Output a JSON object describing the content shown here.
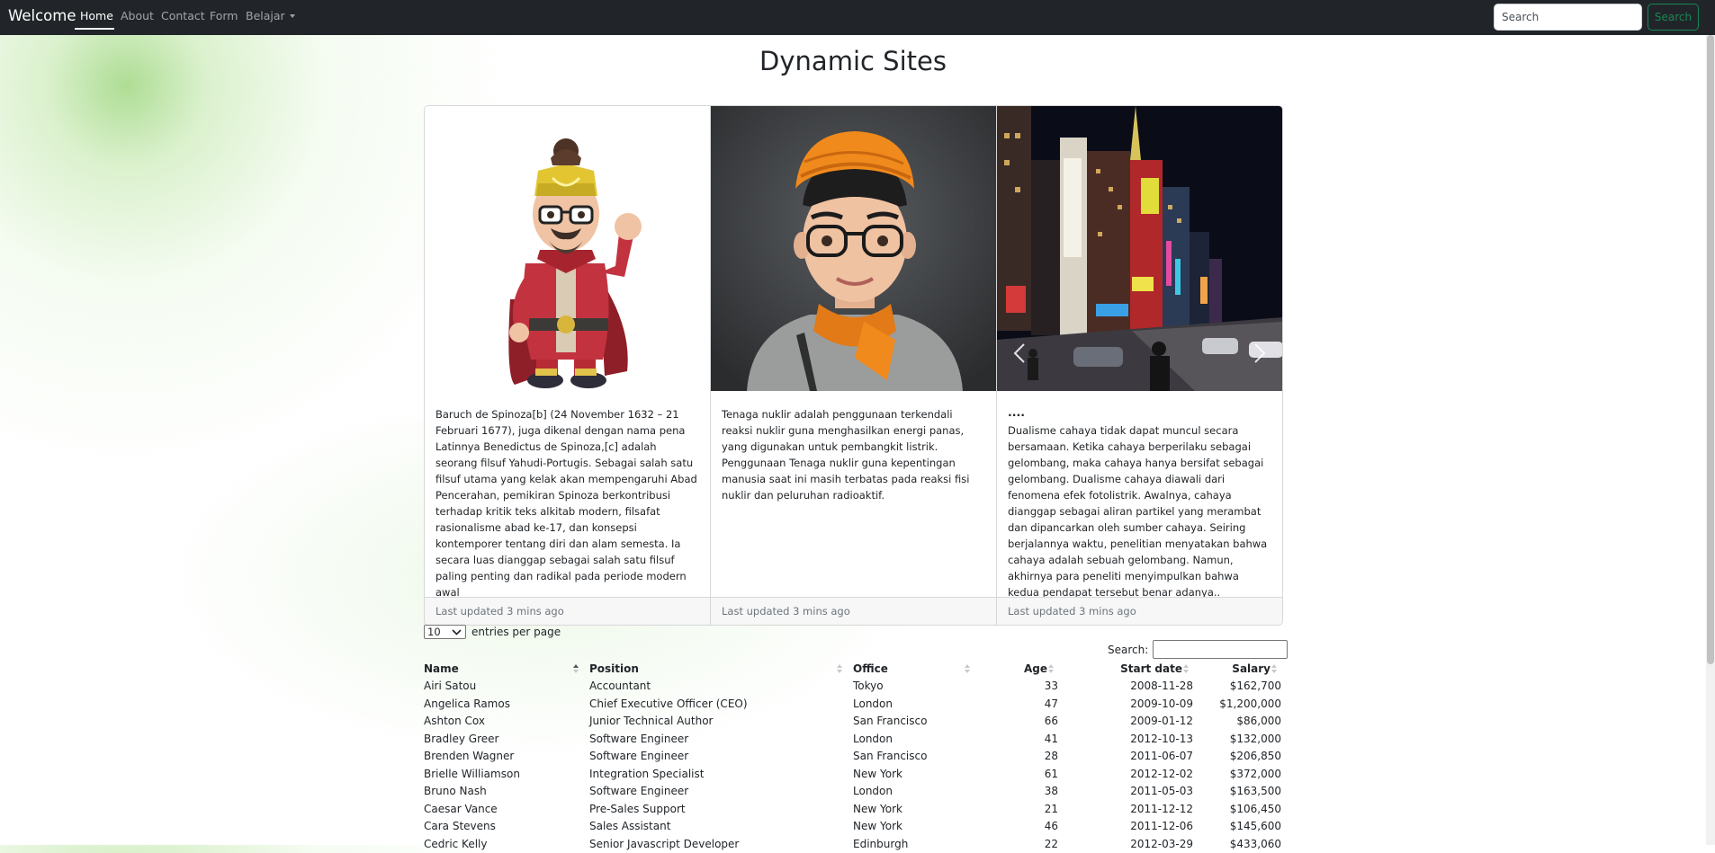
{
  "navbar": {
    "brand": "Welcome",
    "links": [
      "Home",
      "About",
      "Contact",
      "Form",
      "Belajar"
    ],
    "active": "Home",
    "search_placeholder": "Search",
    "search_button": "Search",
    "button_color": "#198754"
  },
  "page_title": "Dynamic Sites",
  "cards": [
    {
      "image": "cartoon-character-illustration",
      "title": "",
      "text": "Baruch de Spinoza[b] (24 November 1632 – 21 Februari 1677), juga dikenal dengan nama pena Latinnya Benedictus de Spinoza,[c] adalah seorang filsuf Yahudi-Portugis. Sebagai salah satu filsuf utama yang kelak akan mempengaruhi Abad Pencerahan, pemikiran Spinoza berkontribusi terhadap kritik teks alkitab modern, filsafat rasionalisme abad ke-17, dan konsepsi kontemporer tentang diri dan alam semesta. Ia secara luas dianggap sebagai salah satu filsuf paling penting dan radikal pada periode modern awal",
      "footer": "Last updated 3 mins ago"
    },
    {
      "image": "portrait-with-orange-turban",
      "title": "",
      "text": "Tenaga nuklir adalah penggunaan terkendali reaksi nuklir guna menghasilkan energi panas, yang digunakan untuk pembangkit listrik. Penggunaan Tenaga nuklir guna kepentingan manusia saat ini masih terbatas pada reaksi fisi nuklir dan peluruhan radioaktif.",
      "footer": "Last updated 3 mins ago"
    },
    {
      "image": "city-street-at-night",
      "title": "....",
      "text": "Dualisme cahaya tidak dapat muncul secara bersamaan. Ketika cahaya berperilaku sebagai gelombang, maka cahaya hanya bersifat sebagai gelombang. Dualisme cahaya diawali dari fenomena efek fotolistrik. Awalnya, cahaya dianggap sebagai aliran partikel yang merambat dan dipancarkan oleh sumber cahaya. Seiring berjalannya waktu, penelitian menyatakan bahwa cahaya adalah sebuah gelombang. Namun, akhirnya para peneliti menyimpulkan bahwa kedua pendapat tersebut benar adanya..",
      "footer": "Last updated 3 mins ago"
    }
  ],
  "datatable": {
    "per_page_value": "10",
    "per_page_label": "entries per page",
    "search_label": "Search:",
    "columns": [
      "Name",
      "Position",
      "Office",
      "Age",
      "Start date",
      "Salary"
    ],
    "sorted_column": "Name",
    "sort_direction": "ascending",
    "rows": [
      [
        "Airi Satou",
        "Accountant",
        "Tokyo",
        "33",
        "2008-11-28",
        "$162,700"
      ],
      [
        "Angelica Ramos",
        "Chief Executive Officer (CEO)",
        "London",
        "47",
        "2009-10-09",
        "$1,200,000"
      ],
      [
        "Ashton Cox",
        "Junior Technical Author",
        "San Francisco",
        "66",
        "2009-01-12",
        "$86,000"
      ],
      [
        "Bradley Greer",
        "Software Engineer",
        "London",
        "41",
        "2012-10-13",
        "$132,000"
      ],
      [
        "Brenden Wagner",
        "Software Engineer",
        "San Francisco",
        "28",
        "2011-06-07",
        "$206,850"
      ],
      [
        "Brielle Williamson",
        "Integration Specialist",
        "New York",
        "61",
        "2012-12-02",
        "$372,000"
      ],
      [
        "Bruno Nash",
        "Software Engineer",
        "London",
        "38",
        "2011-05-03",
        "$163,500"
      ],
      [
        "Caesar Vance",
        "Pre-Sales Support",
        "New York",
        "21",
        "2011-12-12",
        "$106,450"
      ],
      [
        "Cara Stevens",
        "Sales Assistant",
        "New York",
        "46",
        "2011-12-06",
        "$145,600"
      ],
      [
        "Cedric Kelly",
        "Senior Javascript Developer",
        "Edinburgh",
        "22",
        "2012-03-29",
        "$433,060"
      ]
    ]
  }
}
